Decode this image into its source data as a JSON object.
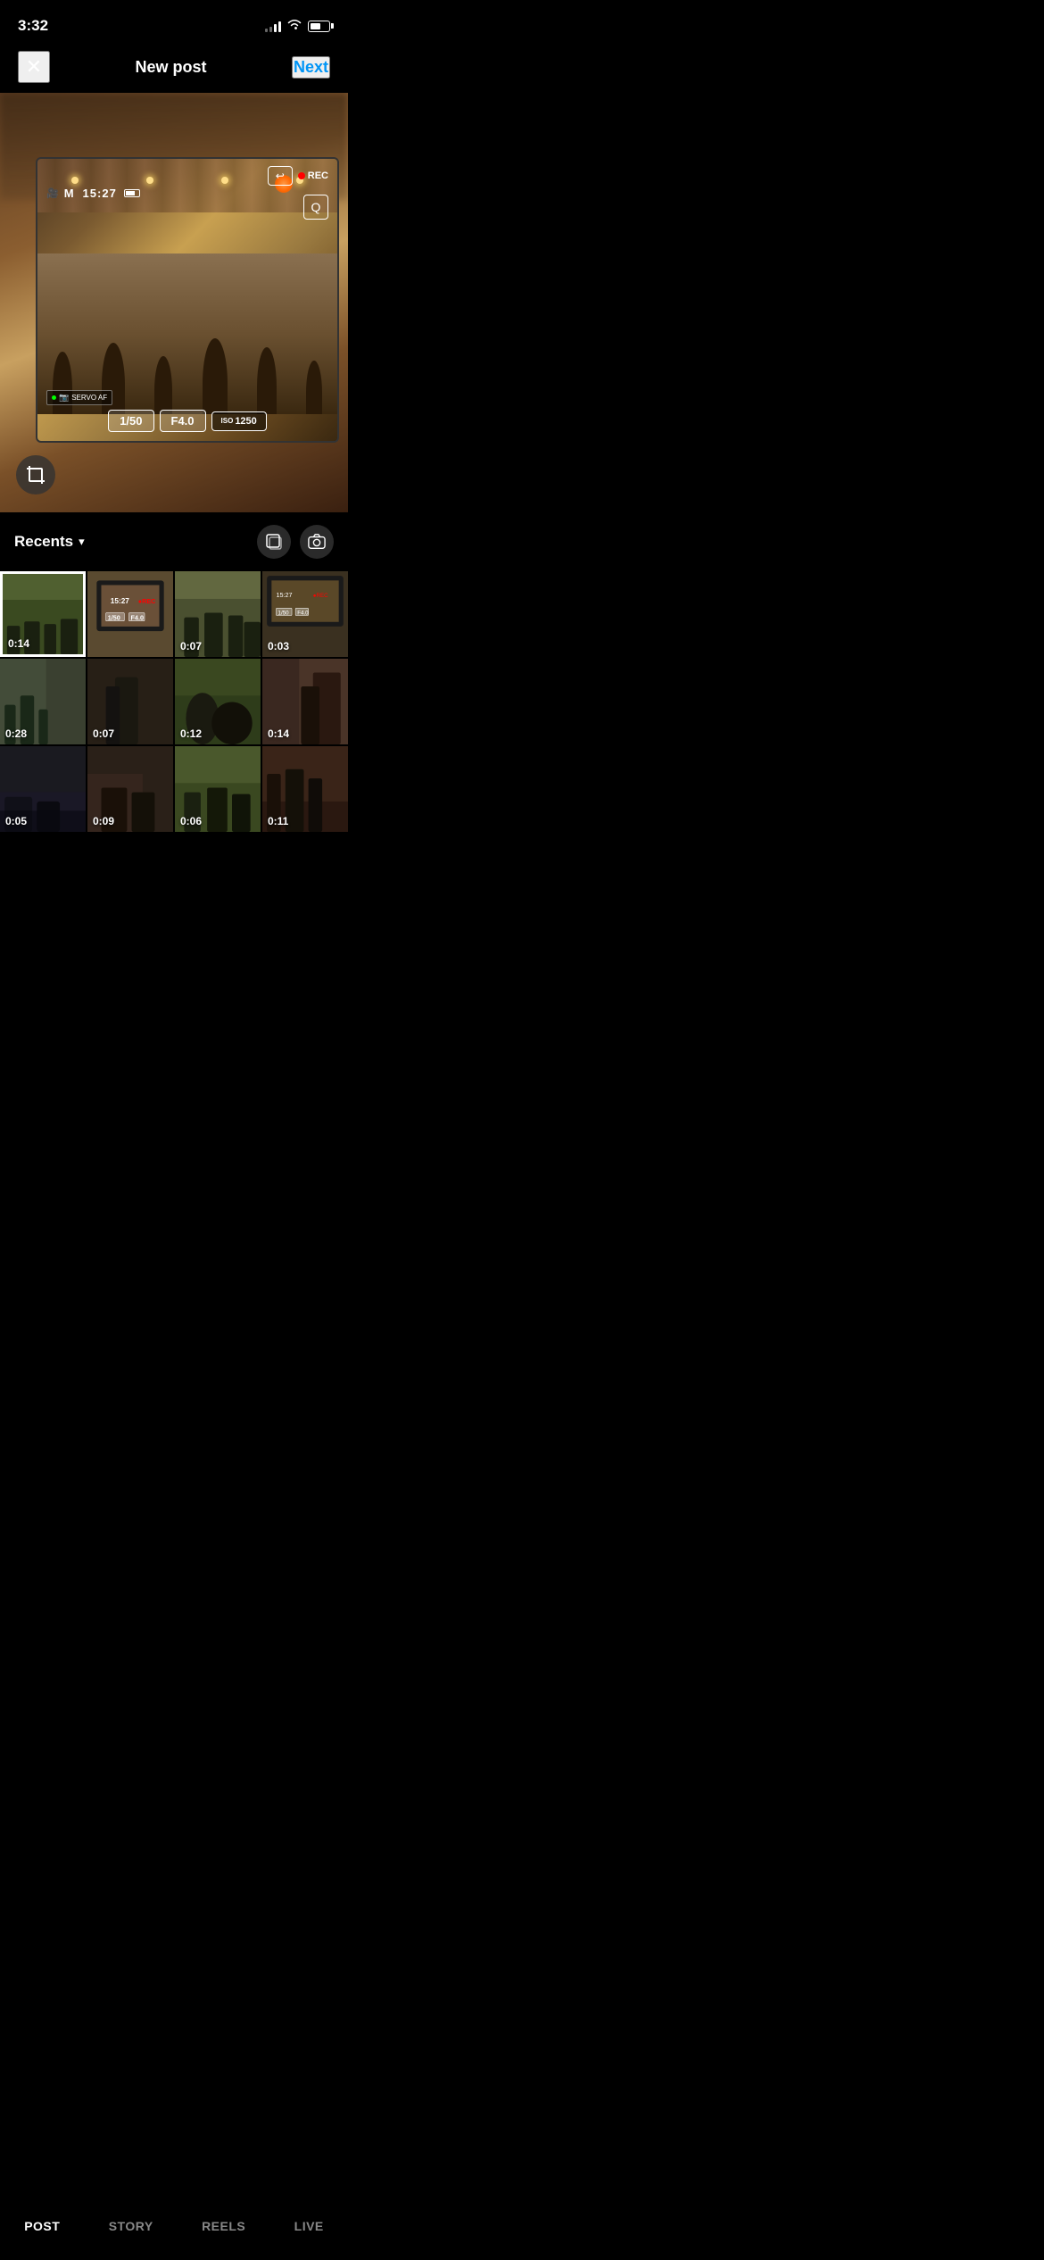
{
  "statusBar": {
    "time": "3:32",
    "signalBars": [
      3,
      5,
      7,
      9
    ],
    "signalActive": 2
  },
  "navBar": {
    "closeLabel": "✕",
    "title": "New post",
    "nextLabel": "Next"
  },
  "cameraOverlay": {
    "mode": "M",
    "time": "15:27",
    "rec": "●REC",
    "shutter": "1/50",
    "aperture": "F4.0",
    "iso": "1250",
    "servoAF": "SERVO AF"
  },
  "gallery": {
    "recentsLabel": "Recents",
    "multiSelectIcon": "⊡",
    "cameraIcon": "⊙",
    "thumbnails": [
      {
        "id": 1,
        "duration": "0:14",
        "colorClass": "t1",
        "selected": true
      },
      {
        "id": 2,
        "duration": "",
        "colorClass": "t2",
        "selected": false
      },
      {
        "id": 3,
        "duration": "0:07",
        "colorClass": "t3",
        "selected": false
      },
      {
        "id": 4,
        "duration": "0:03",
        "colorClass": "t4",
        "selected": false
      },
      {
        "id": 5,
        "duration": "0:28",
        "colorClass": "t5",
        "selected": false
      },
      {
        "id": 6,
        "duration": "0:07",
        "colorClass": "t6",
        "selected": false
      },
      {
        "id": 7,
        "duration": "0:12",
        "colorClass": "t7",
        "selected": false
      },
      {
        "id": 8,
        "duration": "0:14",
        "colorClass": "t8",
        "selected": false
      },
      {
        "id": 9,
        "duration": "0:05",
        "colorClass": "t9",
        "selected": false
      },
      {
        "id": 10,
        "duration": "0:09",
        "colorClass": "t10",
        "selected": false
      },
      {
        "id": 11,
        "duration": "0:06",
        "colorClass": "t11",
        "selected": false
      },
      {
        "id": 12,
        "duration": "0:11",
        "colorClass": "t12",
        "selected": false
      }
    ]
  },
  "bottomNav": {
    "tabs": [
      {
        "id": "post",
        "label": "POST",
        "active": true
      },
      {
        "id": "story",
        "label": "STORY",
        "active": false
      },
      {
        "id": "reels",
        "label": "REELS",
        "active": false
      },
      {
        "id": "live",
        "label": "LIVE",
        "active": false
      }
    ]
  }
}
